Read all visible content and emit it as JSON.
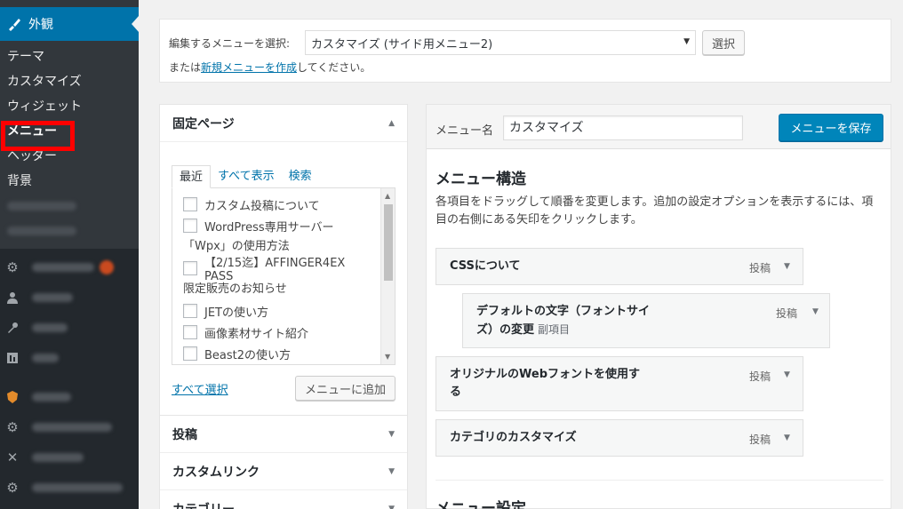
{
  "sidebar": {
    "current_section": "外観",
    "submenu": [
      "テーマ",
      "カスタマイズ",
      "ウィジェット",
      "メニュー",
      "ヘッダー",
      "背景"
    ],
    "active_item": "メニュー"
  },
  "top_bar": {
    "select_label": "編集するメニューを選択:",
    "selected_menu": "カスタマイズ (サイド用メニュー2)",
    "select_button": "選択",
    "note_prefix": "または",
    "note_link": "新規メニューを作成",
    "note_suffix": "してください。"
  },
  "pages_panel": {
    "title": "固定ページ",
    "tabs": [
      "最近",
      "すべて表示",
      "検索"
    ],
    "items": [
      {
        "lines": [
          "カスタム投稿について"
        ]
      },
      {
        "lines": [
          "WordPress専用サーバー",
          "「Wpx」の使用方法"
        ]
      },
      {
        "lines": [
          "【2/15迄】AFFINGER4EX PASS",
          "限定販売のお知らせ"
        ]
      },
      {
        "lines": [
          "JETの使い方"
        ]
      },
      {
        "lines": [
          "画像素材サイト紹介"
        ]
      },
      {
        "lines": [
          "Beast2の使い方"
        ]
      }
    ],
    "select_all": "すべて選択",
    "add_button": "メニューに追加"
  },
  "other_panels": [
    "投稿",
    "カスタムリンク",
    "カテゴリー"
  ],
  "menu_editor": {
    "name_label": "メニュー名",
    "name_value": "カスタマイズ",
    "save_button": "メニューを保存",
    "structure_title": "メニュー構造",
    "structure_desc": "各項目をドラッグして順番を変更します。追加の設定オプションを表示するには、項目の右側にある矢印をクリックします。",
    "items": [
      {
        "title_lines": [
          "CSSについて"
        ],
        "sub": "",
        "type": "投稿"
      },
      {
        "title_lines": [
          "デフォルトの文字（フォントサイ",
          "ズ）の変更"
        ],
        "sub": "副項目",
        "type": "投稿"
      },
      {
        "title_lines": [
          "オリジナルのWebフォントを使用す",
          "る"
        ],
        "sub": "",
        "type": "投稿"
      },
      {
        "title_lines": [
          "カテゴリのカスタマイズ"
        ],
        "sub": "",
        "type": "投稿"
      }
    ],
    "settings_title": "メニュー設定"
  }
}
